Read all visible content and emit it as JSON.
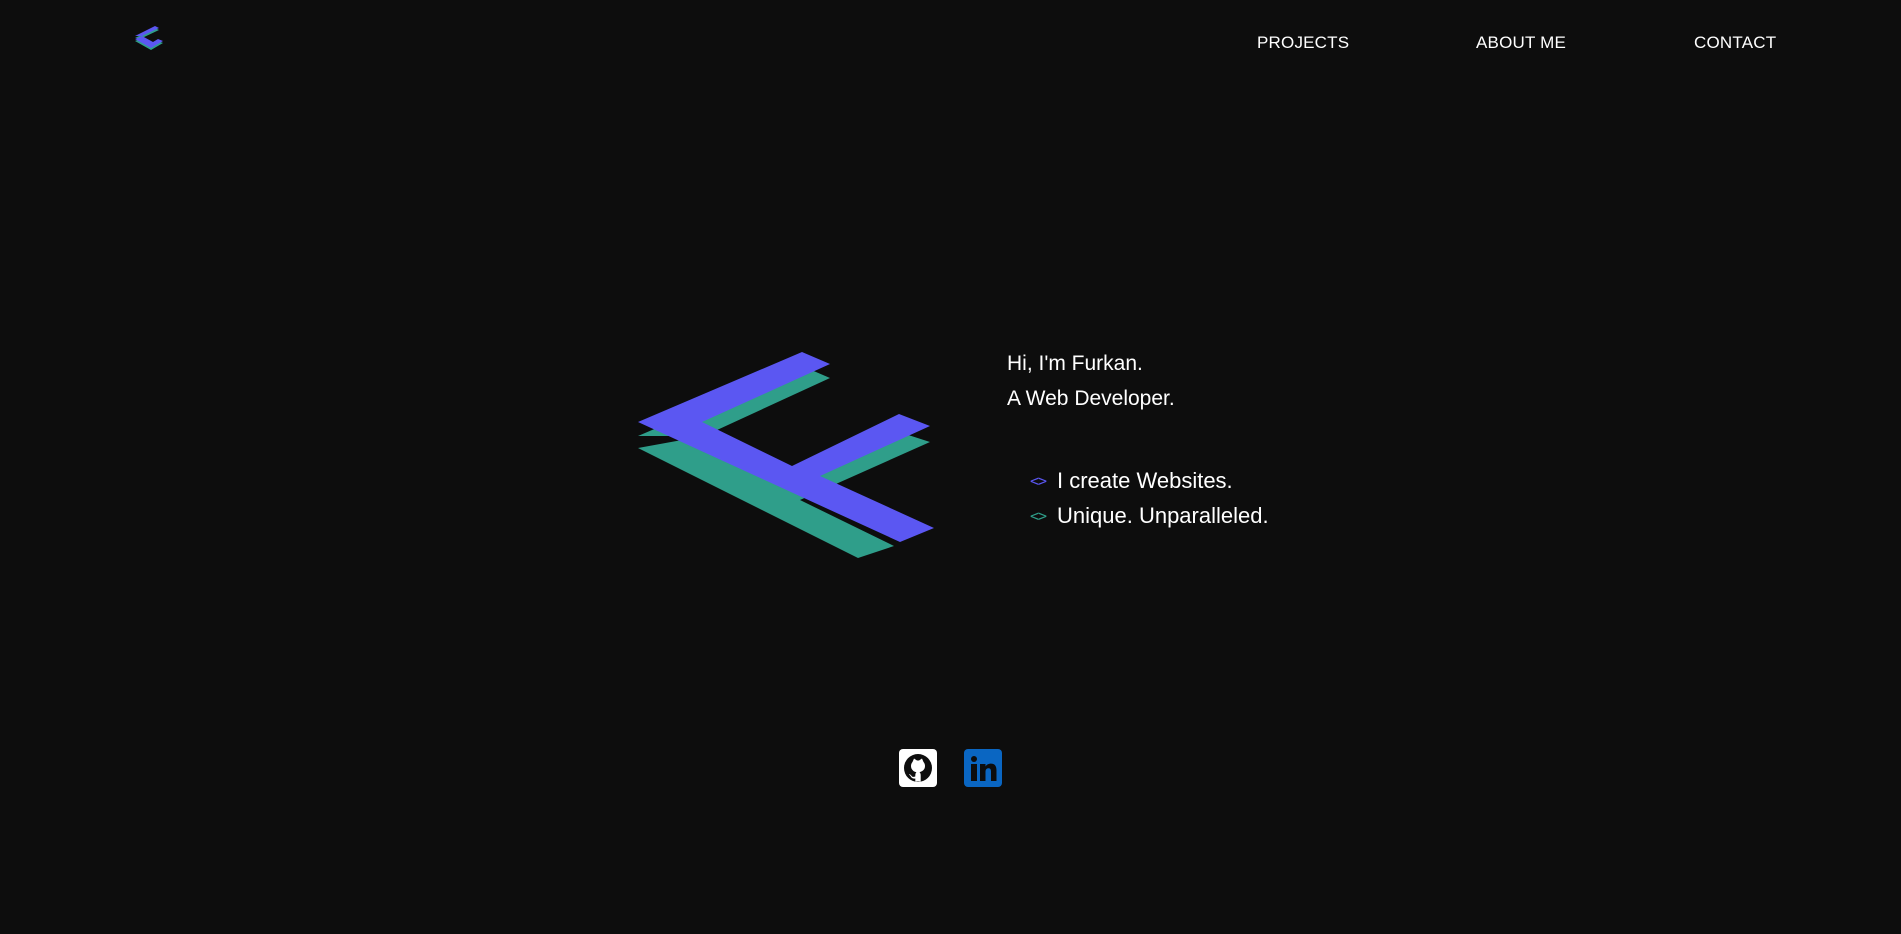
{
  "brand": {
    "logo_icon": "fk-logo-icon",
    "accent_primary": "#5b57f2",
    "accent_secondary": "#2f9e8a"
  },
  "nav": {
    "items": [
      {
        "label": "PROJECTS"
      },
      {
        "label": "ABOUT ME"
      },
      {
        "label": "CONTACT"
      }
    ]
  },
  "hero": {
    "greeting": "Hi, I'm Furkan.",
    "role": "A Web Developer.",
    "taglines": [
      {
        "icon": "<>",
        "text": "I create Websites.",
        "icon_color": "#5b57f2"
      },
      {
        "icon": "<>",
        "text": "Unique. Unparalleled.",
        "icon_color": "#2f9e8a"
      }
    ]
  },
  "social": {
    "github_icon": "github-icon",
    "linkedin_icon": "linkedin-icon",
    "linkedin_text": "in"
  }
}
